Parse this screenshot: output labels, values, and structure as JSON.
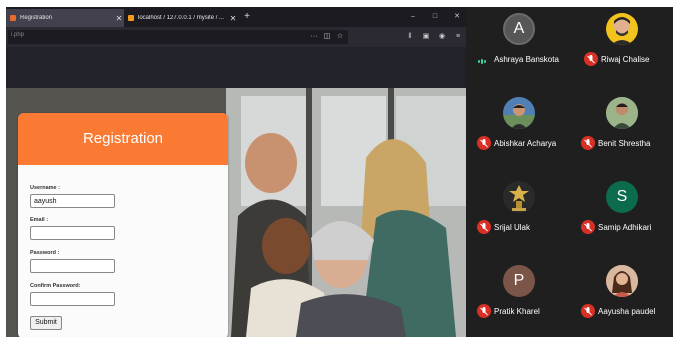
{
  "browser": {
    "tabs": [
      {
        "title": "Registration",
        "active": true
      },
      {
        "title": "localhost / 127.0.0.1 / mysite / ...",
        "active": false
      }
    ],
    "new_tab": "+",
    "window_controls": [
      "–",
      "□",
      "✕"
    ],
    "url": "i.php"
  },
  "form": {
    "title": "Registration",
    "fields": [
      {
        "label": "Username :",
        "value": "aayush"
      },
      {
        "label": "Email :",
        "value": ""
      },
      {
        "label": "Password :",
        "value": ""
      },
      {
        "label": "Confirm Password:",
        "value": ""
      }
    ],
    "submit_label": "Submit"
  },
  "participants": [
    {
      "name": "Ashraya Banskota",
      "initial": "A",
      "avatar_color": "#565656",
      "muted": false,
      "speaking": true
    },
    {
      "name": "Riwaj Chalise",
      "initial": "",
      "avatar_color": "#f3c31d",
      "muted": true,
      "speaking": false
    },
    {
      "name": "Abishkar Acharya",
      "initial": "",
      "avatar_color": "#4f7fb5",
      "muted": true,
      "speaking": false
    },
    {
      "name": "Benit Shrestha",
      "initial": "",
      "avatar_color": "#7c9a6a",
      "muted": true,
      "speaking": false
    },
    {
      "name": "Srijal Ulak",
      "initial": "",
      "avatar_color": "#c9a24a",
      "muted": true,
      "speaking": false
    },
    {
      "name": "Samip Adhikari",
      "initial": "S",
      "avatar_color": "#0b6b4c",
      "muted": true,
      "speaking": false
    },
    {
      "name": "Pratik Kharel",
      "initial": "P",
      "avatar_color": "#7a5548",
      "muted": true,
      "speaking": false
    },
    {
      "name": "Aayusha paudel",
      "initial": "",
      "avatar_color": "#b47a5c",
      "muted": true,
      "speaking": false
    }
  ],
  "colors": {
    "form_header": "#fa7a33",
    "mic_muted": "#d93025",
    "speaking": "#3ad1a7"
  }
}
